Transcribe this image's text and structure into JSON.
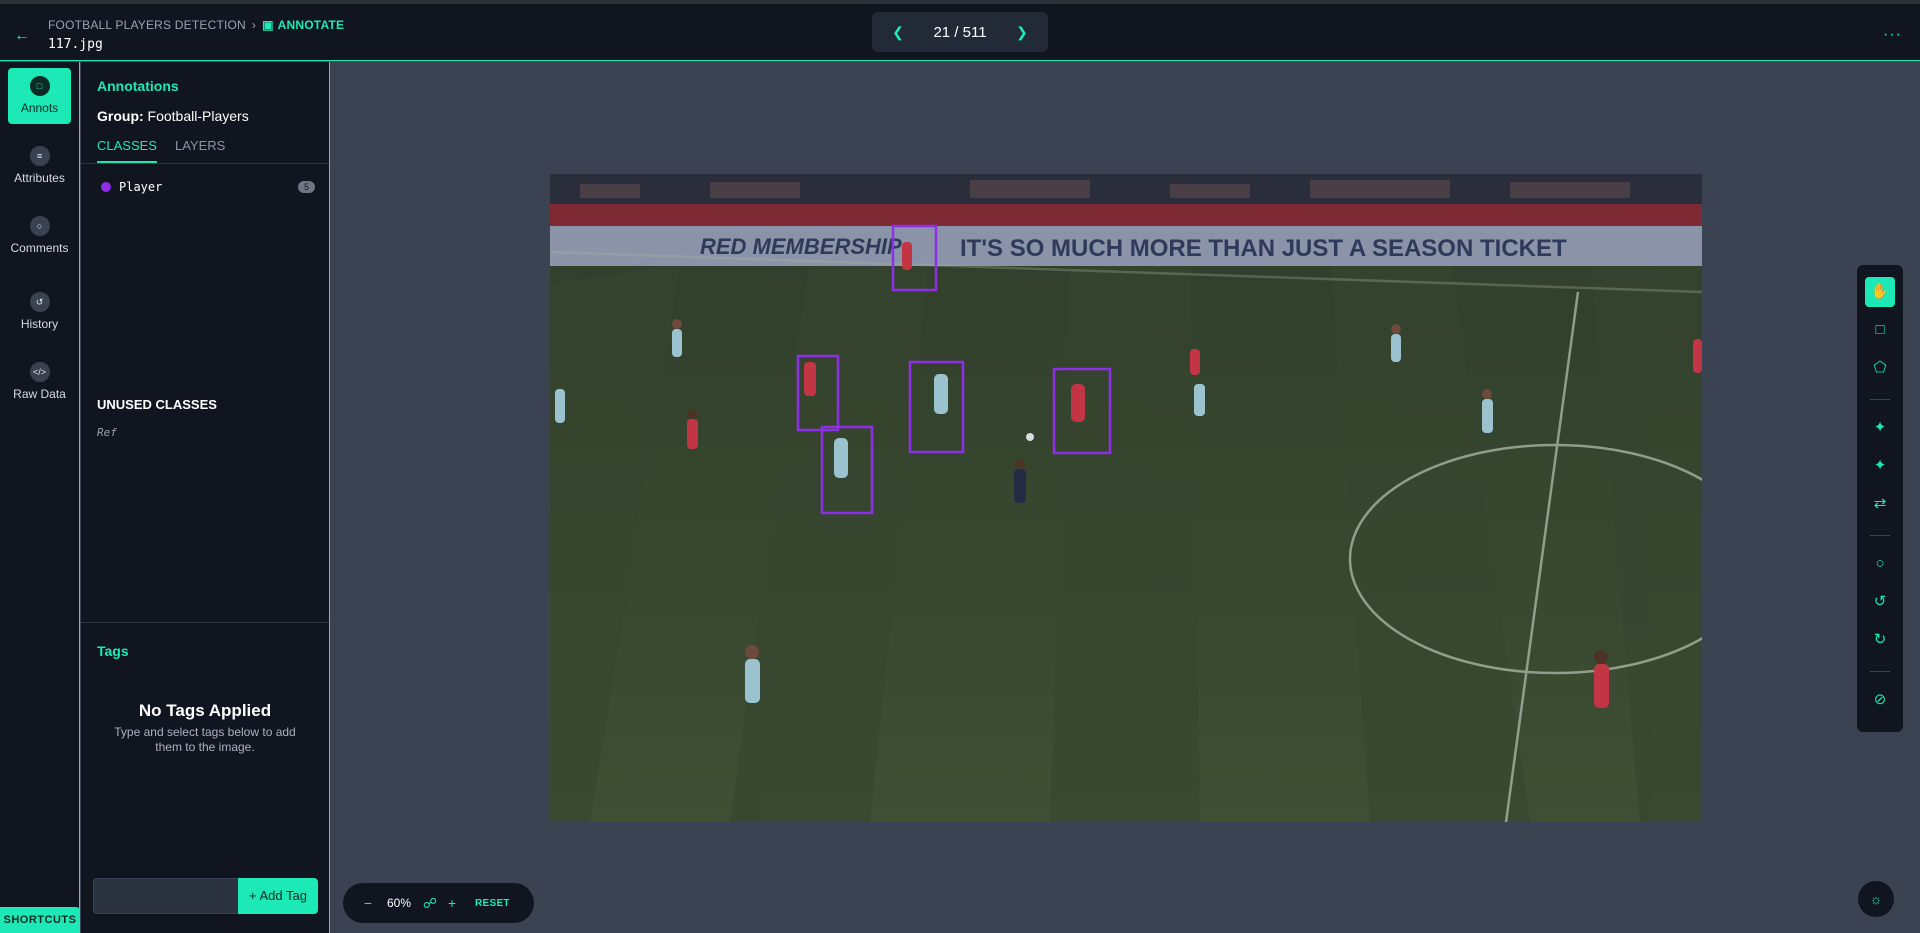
{
  "header": {
    "project": "FOOTBALL PLAYERS DETECTION",
    "mode": "ANNOTATE",
    "filename": "117.jpg",
    "pager": "21 / 511",
    "more_icon": "dots-icon"
  },
  "rail": {
    "items": [
      {
        "label": "Annots",
        "icon": "annotations-icon"
      },
      {
        "label": "Attributes",
        "icon": "list-icon"
      },
      {
        "label": "Comments",
        "icon": "comment-icon"
      },
      {
        "label": "History",
        "icon": "history-icon"
      },
      {
        "label": "Raw Data",
        "icon": "code-icon"
      }
    ],
    "shortcuts": "SHORTCUTS"
  },
  "panel": {
    "title": "Annotations",
    "group_label": "Group:",
    "group_value": "Football-Players",
    "tabs": [
      "CLASSES",
      "LAYERS"
    ],
    "classes": [
      {
        "name": "Player",
        "count": "5",
        "color": "#8e2ee6"
      }
    ],
    "unused_title": "UNUSED CLASSES",
    "unused_items": [
      "Ref"
    ],
    "tags_title": "Tags",
    "no_tags_title": "No Tags Applied",
    "no_tags_desc": "Type and select tags below to add them to the image.",
    "add_tag": "+ Add Tag"
  },
  "canvas": {
    "banner_text": "RED MEMBERSHIP  IT'S SO MUCH MORE THAN JUST A SEASON TICKET",
    "box_color": "#8e2ee6"
  },
  "zoom": {
    "value": "60%",
    "reset": "RESET"
  },
  "colors": {
    "accent": "#1de9b6",
    "panel_bg": "#10151f",
    "canvas_bg": "#3b4252"
  }
}
